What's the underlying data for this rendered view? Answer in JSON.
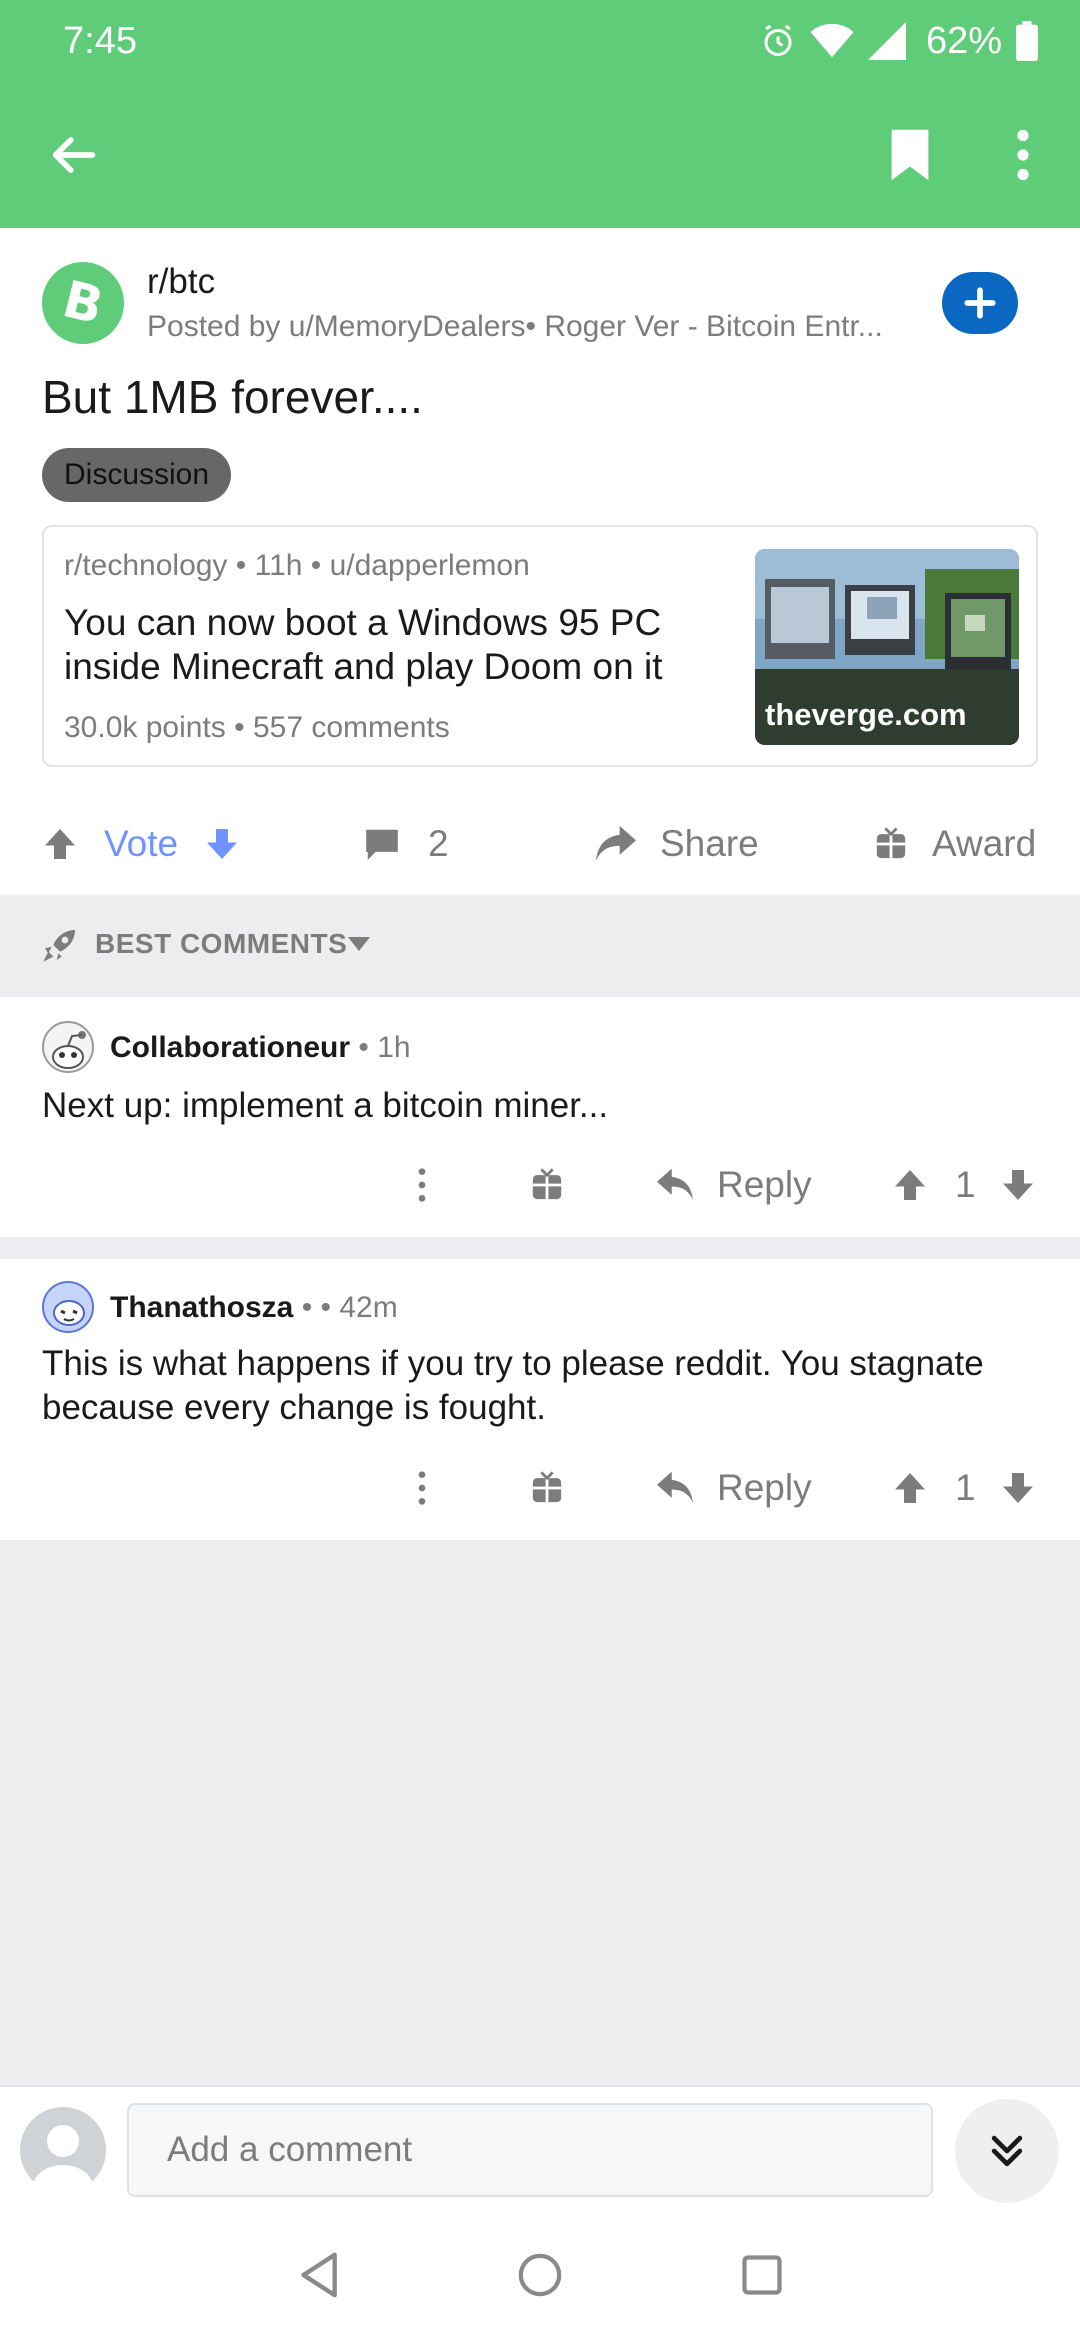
{
  "status_bar": {
    "time": "7:45",
    "battery": "62%",
    "icons": [
      "alarm-icon",
      "wifi-icon",
      "cell-signal-icon",
      "battery-icon"
    ]
  },
  "toolbar": {
    "icons": [
      "back-arrow-icon",
      "bookmark-icon",
      "more-vertical-icon"
    ]
  },
  "post": {
    "subreddit": "r/btc",
    "posted_by": "Posted by u/MemoryDealers• Roger Ver - Bitcoin Entr...",
    "title": "But 1MB forever....",
    "flair": "Discussion",
    "crosspost": {
      "meta": "r/technology • 11h • u/dapperlemon",
      "title": "You can now boot a Windows 95 PC inside Minecraft and play Doom on it",
      "stats": "30.0k points • 557 comments",
      "domain": "theverge.com"
    },
    "actions": {
      "vote": "Vote",
      "comments": "2",
      "share": "Share",
      "award": "Award"
    }
  },
  "sort": {
    "label": "BEST COMMENTS"
  },
  "comments": [
    {
      "author": "Collaborationeur",
      "meta": " • 1h",
      "body": "Next up: implement a bitcoin miner...",
      "reply": "Reply",
      "score": "1"
    },
    {
      "author": "Thanathosza",
      "meta": " •  • 42m",
      "body": "This is what happens if you try to please reddit. You stagnate because every change is fought.",
      "reply": "Reply",
      "score": "1"
    }
  ],
  "composer": {
    "placeholder": "Add a comment"
  },
  "colors": {
    "header": "#5ecc79",
    "vote_accent": "#7193ff",
    "join_button": "#0a68c2",
    "meta_gray": "#7c7c7c",
    "background_gray": "#ededf0"
  }
}
